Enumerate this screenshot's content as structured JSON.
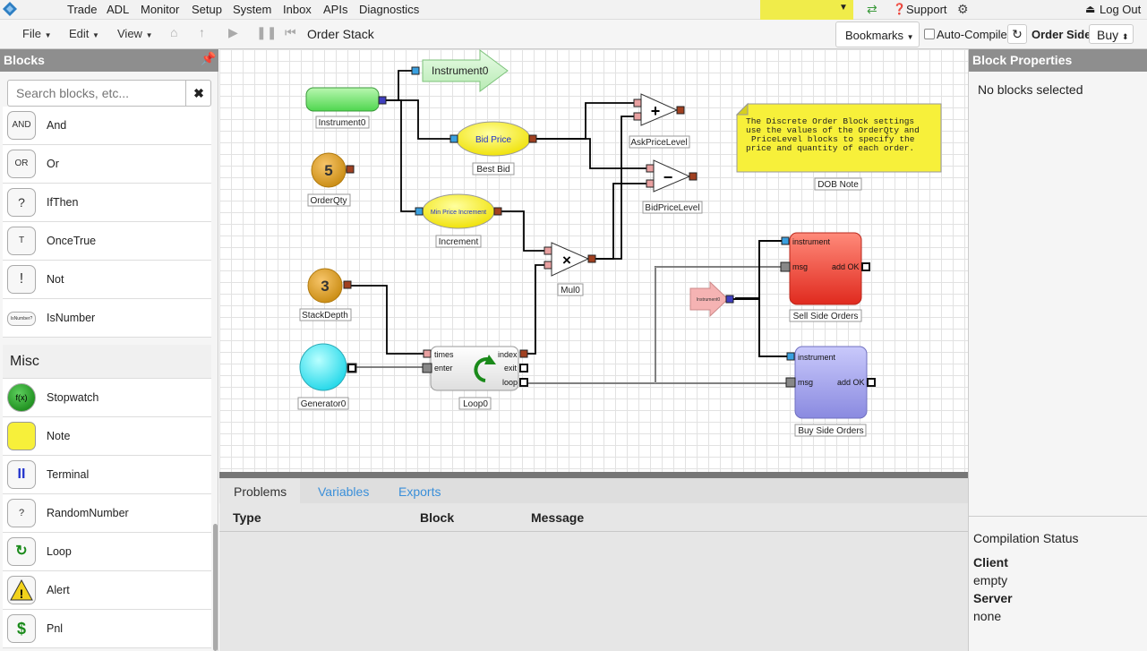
{
  "nav": {
    "items": [
      "Trade",
      "ADL",
      "Monitor",
      "Setup",
      "System",
      "Inbox",
      "APIs",
      "Diagnostics"
    ],
    "support": "Support",
    "logout": "Log Out"
  },
  "toolbar": {
    "file": "File",
    "edit": "Edit",
    "view": "View",
    "title": "Order Stack",
    "bookmarks": "Bookmarks",
    "auto_compile": "Auto-Compile",
    "order_side_label": "Order Side",
    "order_side_value": "Buy"
  },
  "left": {
    "header": "Blocks",
    "search_placeholder": "Search blocks, etc...",
    "logic": [
      {
        "label": "And",
        "glyph": "AND"
      },
      {
        "label": "Or",
        "glyph": "OR"
      },
      {
        "label": "IfThen",
        "glyph": "?"
      },
      {
        "label": "OnceTrue",
        "glyph": "T"
      },
      {
        "label": "Not",
        "glyph": "!"
      },
      {
        "label": "IsNumber",
        "glyph": "IsNumber?"
      }
    ],
    "misc_header": "Misc",
    "misc": [
      {
        "label": "Stopwatch",
        "glyph": "f(x)"
      },
      {
        "label": "Note",
        "glyph": ""
      },
      {
        "label": "Terminal",
        "glyph": "II"
      },
      {
        "label": "RandomNumber",
        "glyph": "?"
      },
      {
        "label": "Loop",
        "glyph": "↻"
      },
      {
        "label": "Alert",
        "glyph": "!"
      },
      {
        "label": "Pnl",
        "glyph": "$"
      }
    ]
  },
  "canvas": {
    "blocks": {
      "instrument0_out": "Instrument0",
      "instrument0": "Instrument0",
      "orderqty_value": "5",
      "orderqty": "OrderQty",
      "best_bid_text": "Bid Price",
      "best_bid": "Best Bid",
      "increment_text": "Min Price Increment",
      "increment": "Increment",
      "stackdepth_value": "3",
      "stackdepth": "StackDepth",
      "ask_price_level": "AskPriceLevel",
      "bid_price_level": "BidPriceLevel",
      "mul0": "Mul0",
      "generator0": "Generator0",
      "loop0": "Loop0",
      "loop_times": "times",
      "loop_enter": "enter",
      "loop_index": "index",
      "loop_exit": "exit",
      "loop_loop": "loop",
      "sell_side": "Sell Side Orders",
      "buy_side": "Buy Side Orders",
      "instrument_port": "instrument",
      "msg_port": "msg",
      "add_ok_port": "add OK",
      "small_instrument": "Instrument0",
      "note_text": [
        "The Discrete Order Block settings",
        "use the values of the OrderQty and",
        "PriceLevel blocks to specify the",
        "price and quantity of each order."
      ],
      "dob_note": "DOB Note"
    }
  },
  "bottom": {
    "tabs": [
      "Problems",
      "Variables",
      "Exports"
    ],
    "columns": [
      "Type",
      "Block",
      "Message"
    ]
  },
  "right": {
    "header": "Block Properties",
    "none_selected": "No blocks selected",
    "compilation_status": "Compilation Status",
    "client_label": "Client",
    "client_value": "empty",
    "server_label": "Server",
    "server_value": "none"
  },
  "colors": {
    "accent": "#3a8fd9",
    "note": "#f7f03a",
    "sell": "#e8433a",
    "buy": "#9a9ae6",
    "wire": "#000000"
  }
}
